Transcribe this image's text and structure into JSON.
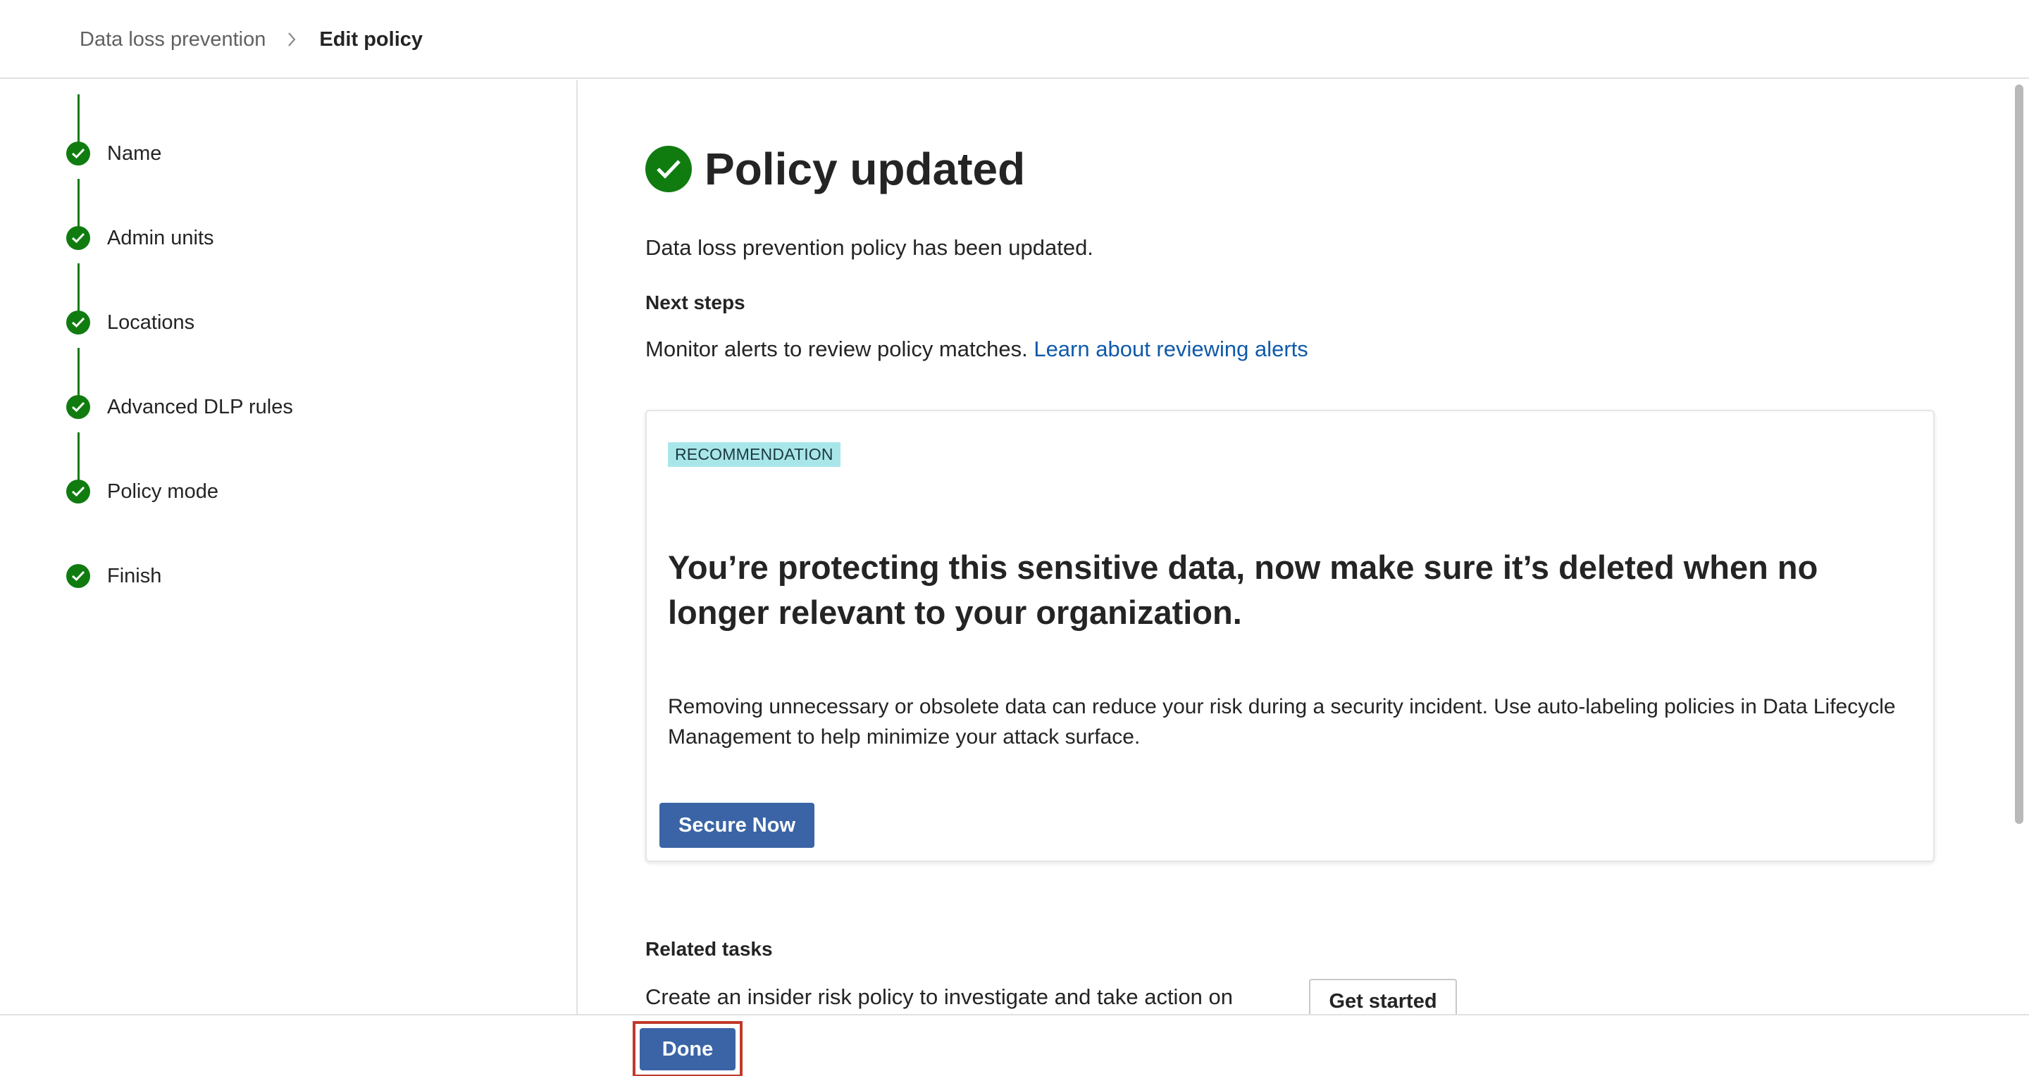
{
  "breadcrumb": {
    "parent": "Data loss prevention",
    "current": "Edit policy"
  },
  "steps": [
    {
      "label": "Name",
      "status": "complete"
    },
    {
      "label": "Admin units",
      "status": "complete"
    },
    {
      "label": "Locations",
      "status": "complete"
    },
    {
      "label": "Advanced DLP rules",
      "status": "complete"
    },
    {
      "label": "Policy mode",
      "status": "complete"
    },
    {
      "label": "Finish",
      "status": "complete"
    }
  ],
  "main": {
    "title": "Policy updated",
    "intro": "Data loss prevention policy has been updated.",
    "next_steps_heading": "Next steps",
    "monitor_text": "Monitor alerts to review policy matches.",
    "monitor_link": "Learn about reviewing alerts"
  },
  "recommendation": {
    "badge": "RECOMMENDATION",
    "heading": "You’re protecting this sensitive data, now make sure it’s deleted when no longer relevant to your organization.",
    "body": "Removing unnecessary or obsolete data can reduce your risk during a security incident. Use auto-labeling policies in Data Lifecycle Management to help minimize your attack surface.",
    "button": "Secure Now"
  },
  "related": {
    "heading": "Related tasks",
    "text": "Create an insider risk policy to investigate and take action on",
    "button": "Get started"
  },
  "footer": {
    "done_label": "Done"
  },
  "colors": {
    "success": "#107c10",
    "primary": "#3a64a6",
    "link": "#0f5aa8",
    "badge_bg": "#a9e6ea",
    "highlight": "#c0392b"
  }
}
